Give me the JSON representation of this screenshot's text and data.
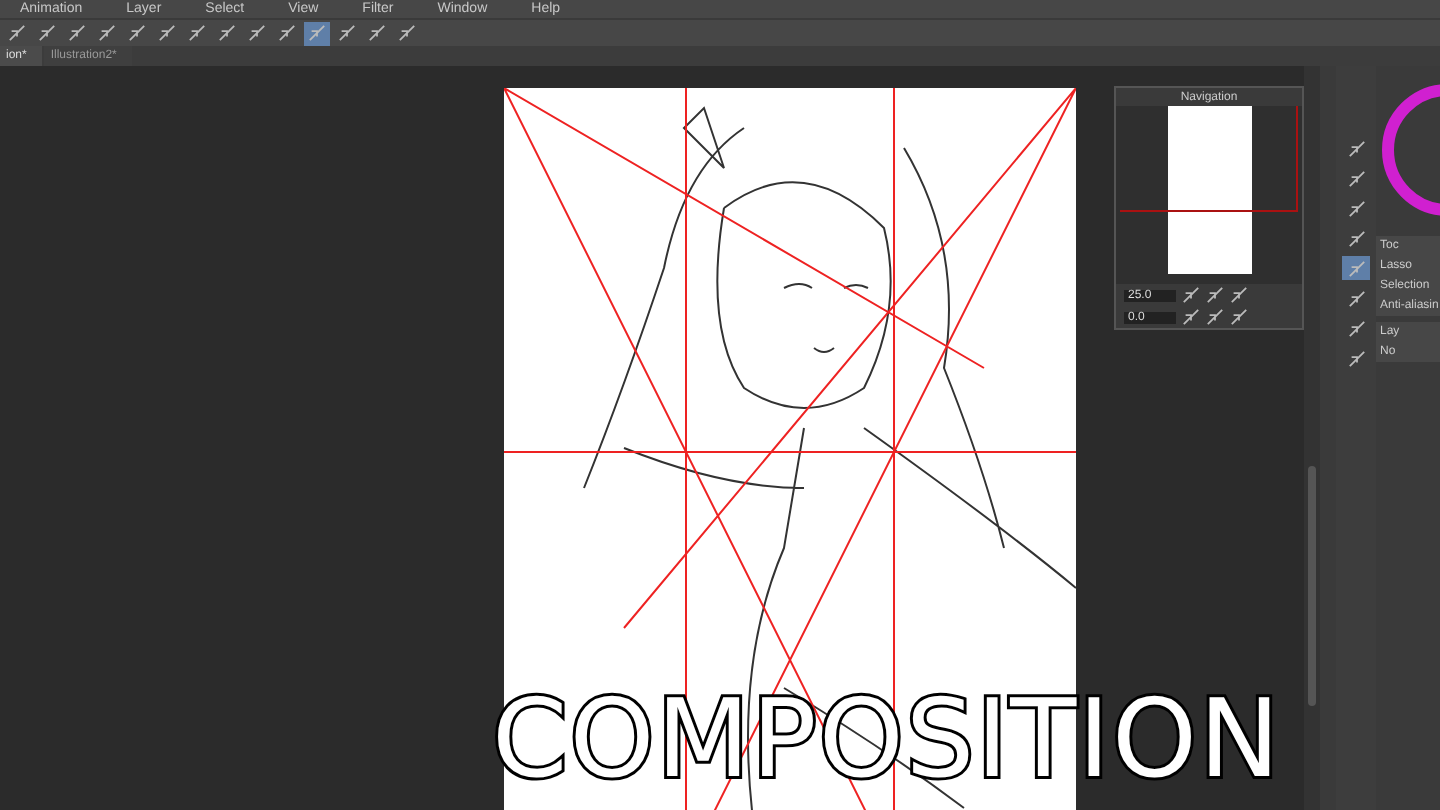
{
  "menu": [
    "Animation",
    "Layer",
    "Select",
    "View",
    "Filter",
    "Window",
    "Help"
  ],
  "toolbar": [
    {
      "selected": false
    },
    {
      "selected": false
    },
    {
      "selected": false
    },
    {
      "selected": false
    },
    {
      "selected": false
    },
    {
      "selected": false
    },
    {
      "selected": false
    },
    {
      "selected": false
    },
    {
      "selected": false
    },
    {
      "selected": false
    },
    {
      "selected": true
    },
    {
      "selected": false
    },
    {
      "selected": false
    },
    {
      "selected": false
    }
  ],
  "tabs": [
    {
      "label": "ion*",
      "selected": true
    },
    {
      "label": "Illustration2*",
      "selected": false
    }
  ],
  "navigator": {
    "title": "Navigation",
    "zoom": "25.0",
    "angle": "0.0"
  },
  "tools": [
    {
      "selected": false
    },
    {
      "selected": false
    },
    {
      "selected": false
    },
    {
      "selected": false
    },
    {
      "selected": true
    },
    {
      "selected": false
    },
    {
      "selected": false
    },
    {
      "selected": false
    }
  ],
  "tool_property": {
    "tab": "Toc",
    "tool_name": "Lasso",
    "rows": [
      "Selection",
      "Anti-aliasin"
    ]
  },
  "layer_panel": {
    "tab": "Lay",
    "blend_mode": "No"
  },
  "overlay_title": "COMPOSITION"
}
